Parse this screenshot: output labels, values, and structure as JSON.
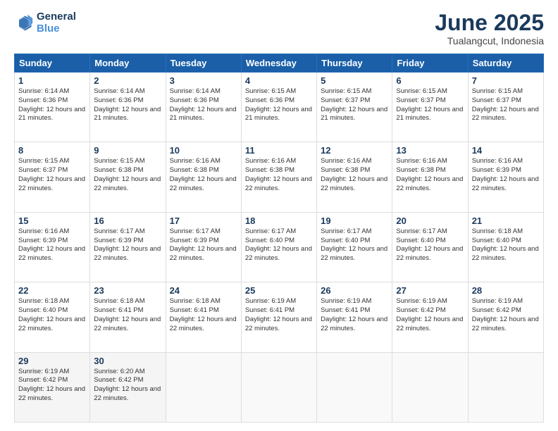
{
  "logo": {
    "line1": "General",
    "line2": "Blue"
  },
  "title": "June 2025",
  "subtitle": "Tualangcut, Indonesia",
  "days_header": [
    "Sunday",
    "Monday",
    "Tuesday",
    "Wednesday",
    "Thursday",
    "Friday",
    "Saturday"
  ],
  "weeks": [
    [
      {
        "day": "1",
        "sunrise": "Sunrise: 6:14 AM",
        "sunset": "Sunset: 6:36 PM",
        "daylight": "Daylight: 12 hours and 21 minutes."
      },
      {
        "day": "2",
        "sunrise": "Sunrise: 6:14 AM",
        "sunset": "Sunset: 6:36 PM",
        "daylight": "Daylight: 12 hours and 21 minutes."
      },
      {
        "day": "3",
        "sunrise": "Sunrise: 6:14 AM",
        "sunset": "Sunset: 6:36 PM",
        "daylight": "Daylight: 12 hours and 21 minutes."
      },
      {
        "day": "4",
        "sunrise": "Sunrise: 6:15 AM",
        "sunset": "Sunset: 6:36 PM",
        "daylight": "Daylight: 12 hours and 21 minutes."
      },
      {
        "day": "5",
        "sunrise": "Sunrise: 6:15 AM",
        "sunset": "Sunset: 6:37 PM",
        "daylight": "Daylight: 12 hours and 21 minutes."
      },
      {
        "day": "6",
        "sunrise": "Sunrise: 6:15 AM",
        "sunset": "Sunset: 6:37 PM",
        "daylight": "Daylight: 12 hours and 21 minutes."
      },
      {
        "day": "7",
        "sunrise": "Sunrise: 6:15 AM",
        "sunset": "Sunset: 6:37 PM",
        "daylight": "Daylight: 12 hours and 22 minutes."
      }
    ],
    [
      {
        "day": "8",
        "sunrise": "Sunrise: 6:15 AM",
        "sunset": "Sunset: 6:37 PM",
        "daylight": "Daylight: 12 hours and 22 minutes."
      },
      {
        "day": "9",
        "sunrise": "Sunrise: 6:15 AM",
        "sunset": "Sunset: 6:38 PM",
        "daylight": "Daylight: 12 hours and 22 minutes."
      },
      {
        "day": "10",
        "sunrise": "Sunrise: 6:16 AM",
        "sunset": "Sunset: 6:38 PM",
        "daylight": "Daylight: 12 hours and 22 minutes."
      },
      {
        "day": "11",
        "sunrise": "Sunrise: 6:16 AM",
        "sunset": "Sunset: 6:38 PM",
        "daylight": "Daylight: 12 hours and 22 minutes."
      },
      {
        "day": "12",
        "sunrise": "Sunrise: 6:16 AM",
        "sunset": "Sunset: 6:38 PM",
        "daylight": "Daylight: 12 hours and 22 minutes."
      },
      {
        "day": "13",
        "sunrise": "Sunrise: 6:16 AM",
        "sunset": "Sunset: 6:38 PM",
        "daylight": "Daylight: 12 hours and 22 minutes."
      },
      {
        "day": "14",
        "sunrise": "Sunrise: 6:16 AM",
        "sunset": "Sunset: 6:39 PM",
        "daylight": "Daylight: 12 hours and 22 minutes."
      }
    ],
    [
      {
        "day": "15",
        "sunrise": "Sunrise: 6:16 AM",
        "sunset": "Sunset: 6:39 PM",
        "daylight": "Daylight: 12 hours and 22 minutes."
      },
      {
        "day": "16",
        "sunrise": "Sunrise: 6:17 AM",
        "sunset": "Sunset: 6:39 PM",
        "daylight": "Daylight: 12 hours and 22 minutes."
      },
      {
        "day": "17",
        "sunrise": "Sunrise: 6:17 AM",
        "sunset": "Sunset: 6:39 PM",
        "daylight": "Daylight: 12 hours and 22 minutes."
      },
      {
        "day": "18",
        "sunrise": "Sunrise: 6:17 AM",
        "sunset": "Sunset: 6:40 PM",
        "daylight": "Daylight: 12 hours and 22 minutes."
      },
      {
        "day": "19",
        "sunrise": "Sunrise: 6:17 AM",
        "sunset": "Sunset: 6:40 PM",
        "daylight": "Daylight: 12 hours and 22 minutes."
      },
      {
        "day": "20",
        "sunrise": "Sunrise: 6:17 AM",
        "sunset": "Sunset: 6:40 PM",
        "daylight": "Daylight: 12 hours and 22 minutes."
      },
      {
        "day": "21",
        "sunrise": "Sunrise: 6:18 AM",
        "sunset": "Sunset: 6:40 PM",
        "daylight": "Daylight: 12 hours and 22 minutes."
      }
    ],
    [
      {
        "day": "22",
        "sunrise": "Sunrise: 6:18 AM",
        "sunset": "Sunset: 6:40 PM",
        "daylight": "Daylight: 12 hours and 22 minutes."
      },
      {
        "day": "23",
        "sunrise": "Sunrise: 6:18 AM",
        "sunset": "Sunset: 6:41 PM",
        "daylight": "Daylight: 12 hours and 22 minutes."
      },
      {
        "day": "24",
        "sunrise": "Sunrise: 6:18 AM",
        "sunset": "Sunset: 6:41 PM",
        "daylight": "Daylight: 12 hours and 22 minutes."
      },
      {
        "day": "25",
        "sunrise": "Sunrise: 6:19 AM",
        "sunset": "Sunset: 6:41 PM",
        "daylight": "Daylight: 12 hours and 22 minutes."
      },
      {
        "day": "26",
        "sunrise": "Sunrise: 6:19 AM",
        "sunset": "Sunset: 6:41 PM",
        "daylight": "Daylight: 12 hours and 22 minutes."
      },
      {
        "day": "27",
        "sunrise": "Sunrise: 6:19 AM",
        "sunset": "Sunset: 6:42 PM",
        "daylight": "Daylight: 12 hours and 22 minutes."
      },
      {
        "day": "28",
        "sunrise": "Sunrise: 6:19 AM",
        "sunset": "Sunset: 6:42 PM",
        "daylight": "Daylight: 12 hours and 22 minutes."
      }
    ],
    [
      {
        "day": "29",
        "sunrise": "Sunrise: 6:19 AM",
        "sunset": "Sunset: 6:42 PM",
        "daylight": "Daylight: 12 hours and 22 minutes."
      },
      {
        "day": "30",
        "sunrise": "Sunrise: 6:20 AM",
        "sunset": "Sunset: 6:42 PM",
        "daylight": "Daylight: 12 hours and 22 minutes."
      },
      {
        "day": "",
        "sunrise": "",
        "sunset": "",
        "daylight": ""
      },
      {
        "day": "",
        "sunrise": "",
        "sunset": "",
        "daylight": ""
      },
      {
        "day": "",
        "sunrise": "",
        "sunset": "",
        "daylight": ""
      },
      {
        "day": "",
        "sunrise": "",
        "sunset": "",
        "daylight": ""
      },
      {
        "day": "",
        "sunrise": "",
        "sunset": "",
        "daylight": ""
      }
    ]
  ]
}
